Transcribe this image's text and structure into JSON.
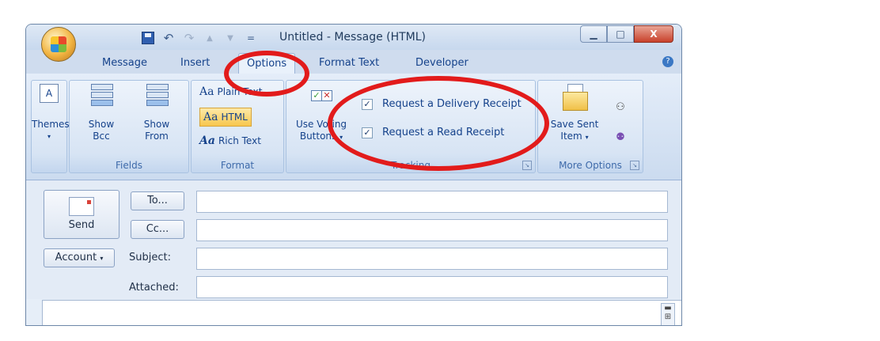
{
  "window": {
    "title": "Untitled - Message (HTML)",
    "controls": {
      "minimize": "▁",
      "maximize": "□",
      "close": "X"
    }
  },
  "quick_access": {
    "save": "save-icon",
    "undo": "↶",
    "redo": "↷",
    "up": "▲",
    "down": "▼",
    "customize": "="
  },
  "tabs": [
    "Message",
    "Insert",
    "Options",
    "Format Text",
    "Developer"
  ],
  "active_tab": "Options",
  "ribbon": {
    "themes": {
      "label": "Themes",
      "caret": "▾",
      "icon": "A"
    },
    "fields": {
      "group_label": "Fields",
      "show_bcc": [
        "Show",
        "Bcc"
      ],
      "show_from": [
        "Show",
        "From"
      ]
    },
    "format": {
      "group_label": "Format",
      "plain_text": "Plain Text",
      "html": "HTML",
      "rich_text": "Rich Text",
      "aa": "Aa"
    },
    "tracking": {
      "group_label": "Tracking",
      "voting": [
        "Use Voting",
        "Buttons"
      ],
      "delivery_receipt": "Request a Delivery Receipt",
      "read_receipt": "Request a Read Receipt",
      "delivery_checked": true,
      "read_checked": true,
      "check": "✓"
    },
    "more_options": {
      "group_label": "More Options",
      "save_sent": [
        "Save Sent",
        "Item"
      ]
    }
  },
  "header": {
    "send": "Send",
    "to": "To...",
    "cc": "Cc...",
    "account": "Account",
    "account_caret": "▾",
    "subject_label": "Subject:",
    "attached_label": "Attached:"
  },
  "accent_color": "#e21b1b"
}
